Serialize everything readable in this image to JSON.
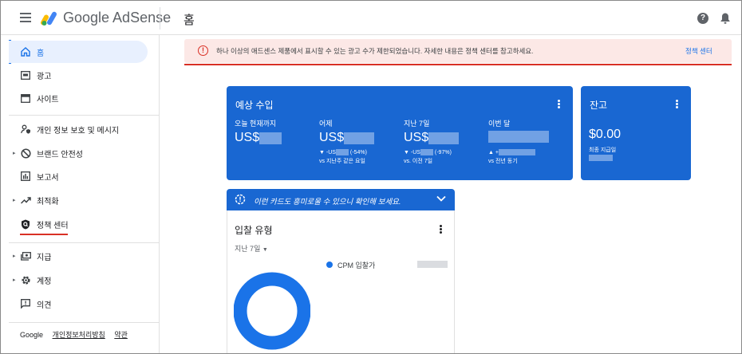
{
  "header": {
    "brand": "Google AdSense",
    "page_title": "홈"
  },
  "sidebar": {
    "items": [
      {
        "label": "홈",
        "icon": "home-icon"
      },
      {
        "label": "광고",
        "icon": "ads-icon"
      },
      {
        "label": "사이트",
        "icon": "sites-icon"
      },
      {
        "label": "개인 정보 보호 및 메시지",
        "icon": "privacy-icon"
      },
      {
        "label": "브랜드 안전성",
        "icon": "block-icon"
      },
      {
        "label": "보고서",
        "icon": "reports-icon"
      },
      {
        "label": "최적화",
        "icon": "trending-up-icon"
      },
      {
        "label": "정책 센터",
        "icon": "policy-shield-icon"
      },
      {
        "label": "지급",
        "icon": "payments-icon"
      },
      {
        "label": "계정",
        "icon": "settings-gear-icon"
      },
      {
        "label": "의견",
        "icon": "feedback-icon"
      }
    ],
    "footer": {
      "google": "Google",
      "privacy": "개인정보처리방침",
      "terms": "약관"
    }
  },
  "alert": {
    "text": "하나 이상의 애드센스 제품에서 표시할 수 있는 광고 수가 제한되었습니다. 자세한 내용은 정책 센터를 참고하세요.",
    "link": "정책 센터"
  },
  "earnings": {
    "title": "예상 수입",
    "metrics": [
      {
        "label": "오늘 현재까지",
        "value": "US$"
      },
      {
        "label": "어제",
        "value": "US$",
        "change": "▼ -US",
        "change_pct": "(-54%)",
        "compare": "vs 지난주 같은 요일"
      },
      {
        "label": "지난 7일",
        "value": "US$",
        "change": "▼ -US",
        "change_pct": "(-97%)",
        "compare": "vs. 이전 7일"
      },
      {
        "label": "이번 달",
        "value": "",
        "change": "▲ +",
        "change_pct": "",
        "compare": "vs 전년 동기"
      }
    ]
  },
  "balance": {
    "title": "잔고",
    "value": "$0.00",
    "sub": "최종 지급일"
  },
  "promo": {
    "text": "이런 카드도 흥미로울 수 있으니 확인해 보세요."
  },
  "bid": {
    "title": "입찰 유형",
    "period": "지난 7일",
    "legend": "CPM 입찰가"
  },
  "colors": {
    "accent": "#1a73e8",
    "card_blue": "#1967d2",
    "alert_bg": "#fce8e6",
    "alert_red": "#d93025"
  }
}
